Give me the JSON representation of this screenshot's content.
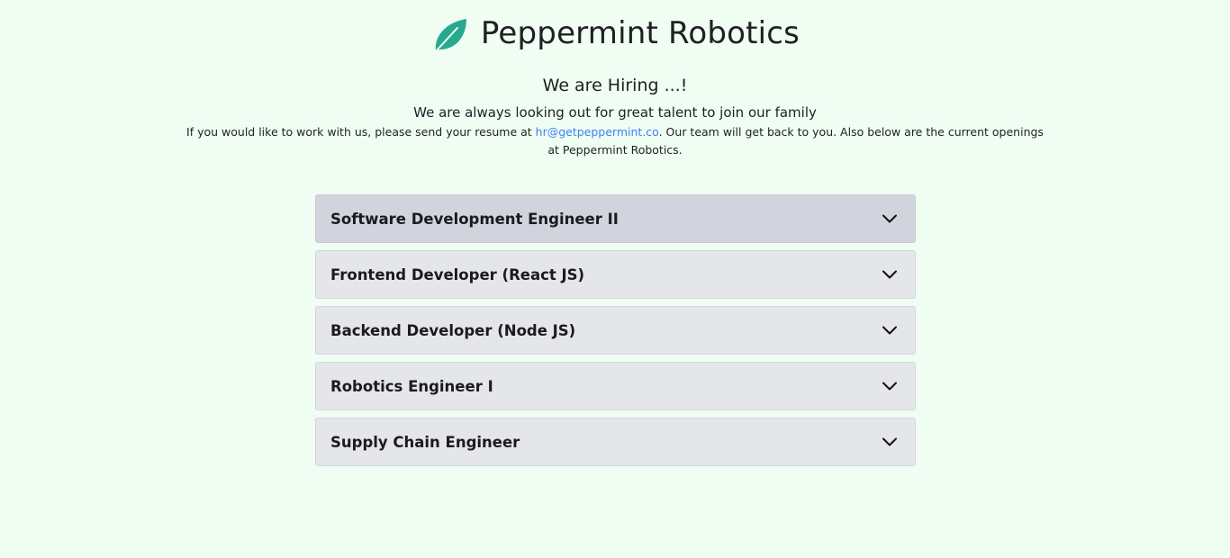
{
  "header": {
    "logo_icon": "leaf-icon",
    "brand_color": "#26a98f",
    "title": "Peppermint Robotics"
  },
  "hero": {
    "heading": "We are Hiring ...!",
    "tagline": "We are always looking out for great talent to join our family",
    "intro_before": "If you would like to work with us, please send your resume at ",
    "email": "hr@getpeppermint.co",
    "intro_after": ". Our team will get back to you. Also below are the current openings at Peppermint Robotics.",
    "link_color": "#3b82f6"
  },
  "openings": {
    "items": [
      {
        "label": "Software Development Engineer II",
        "icon": "chevron-down-icon",
        "highlighted": true
      },
      {
        "label": "Frontend Developer (React JS)",
        "icon": "chevron-down-icon",
        "highlighted": false
      },
      {
        "label": "Backend Developer (Node JS)",
        "icon": "chevron-down-icon",
        "highlighted": false
      },
      {
        "label": "Robotics Engineer I",
        "icon": "chevron-down-icon",
        "highlighted": false
      },
      {
        "label": "Supply Chain Engineer",
        "icon": "chevron-down-icon",
        "highlighted": false
      }
    ]
  }
}
